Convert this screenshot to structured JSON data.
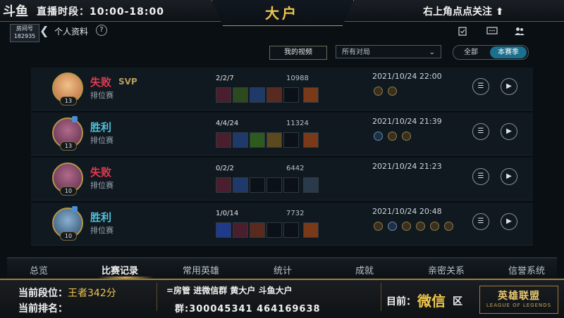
{
  "stream": {
    "logo": "斗鱼",
    "broadcast_time": "直播时段：10:00-18:00",
    "title": "大户",
    "follow_hint": "右上角点点关注 ⬆",
    "room_label": "房间号",
    "room_number": "182935"
  },
  "header": {
    "back_icon": "back-arrow-icon",
    "profile_label": "个人资料",
    "help_glyph": "?",
    "icons": [
      "calendar-check-icon",
      "chat-icon",
      "friends-icon"
    ]
  },
  "filters": {
    "my_video_label": "我的视频",
    "match_filter_value": "所有对局",
    "seg_all_label": "全部",
    "seg_season_label": "本赛季"
  },
  "matches": [
    {
      "result": "失败",
      "result_color": "#e23a4f",
      "svp": "SVP",
      "mode": "排位赛",
      "level": "13",
      "kda": "2/2/7",
      "gold": "10988",
      "date": "2021/10/24 22:00",
      "avatar_color": "#d39a5a",
      "item_count": 6,
      "rune_count": 2
    },
    {
      "result": "胜利",
      "result_color": "#4fc2d9",
      "svp": "",
      "mode": "排位赛",
      "level": "13",
      "kda": "4/4/24",
      "gold": "11324",
      "date": "2021/10/24 21:39",
      "avatar_color": "#8a4a6a",
      "item_count": 6,
      "rune_count": 3
    },
    {
      "result": "失败",
      "result_color": "#e23a4f",
      "svp": "",
      "mode": "排位赛",
      "level": "10",
      "kda": "0/2/2",
      "gold": "6442",
      "date": "2021/10/24 21:23",
      "avatar_color": "#8a4a6a",
      "item_count": 6,
      "rune_count": 0
    },
    {
      "result": "胜利",
      "result_color": "#4fc2d9",
      "svp": "",
      "mode": "排位赛",
      "level": "10",
      "kda": "1/0/14",
      "gold": "7732",
      "date": "2021/10/24 20:48",
      "avatar_color": "#5a8ab0",
      "item_count": 6,
      "rune_count": 6
    }
  ],
  "nav": {
    "items": [
      "总览",
      "比赛记录",
      "常用英雄",
      "统计",
      "成就",
      "亲密关系",
      "信誉系统"
    ],
    "active_index": 1
  },
  "overlay": {
    "current_rank_label": "当前段位：",
    "current_rank_value": "王者342分",
    "current_order_label": "当前排名：",
    "social_line_1": "=房管   进微信群   黄大户   斗鱼大户",
    "social_line_2": "群:300045341  464169638",
    "region_label": "目前：",
    "region_value": "微信",
    "region_suffix": "区",
    "game_logo": "英雄联盟",
    "game_logo_sub": "LEAGUE OF LEGENDS"
  },
  "colors": {
    "accent_gold": "#f0c64a",
    "loss_red": "#e23a4f",
    "win_cyan": "#4fc2d9",
    "season_btn": "#1c6f8d"
  }
}
